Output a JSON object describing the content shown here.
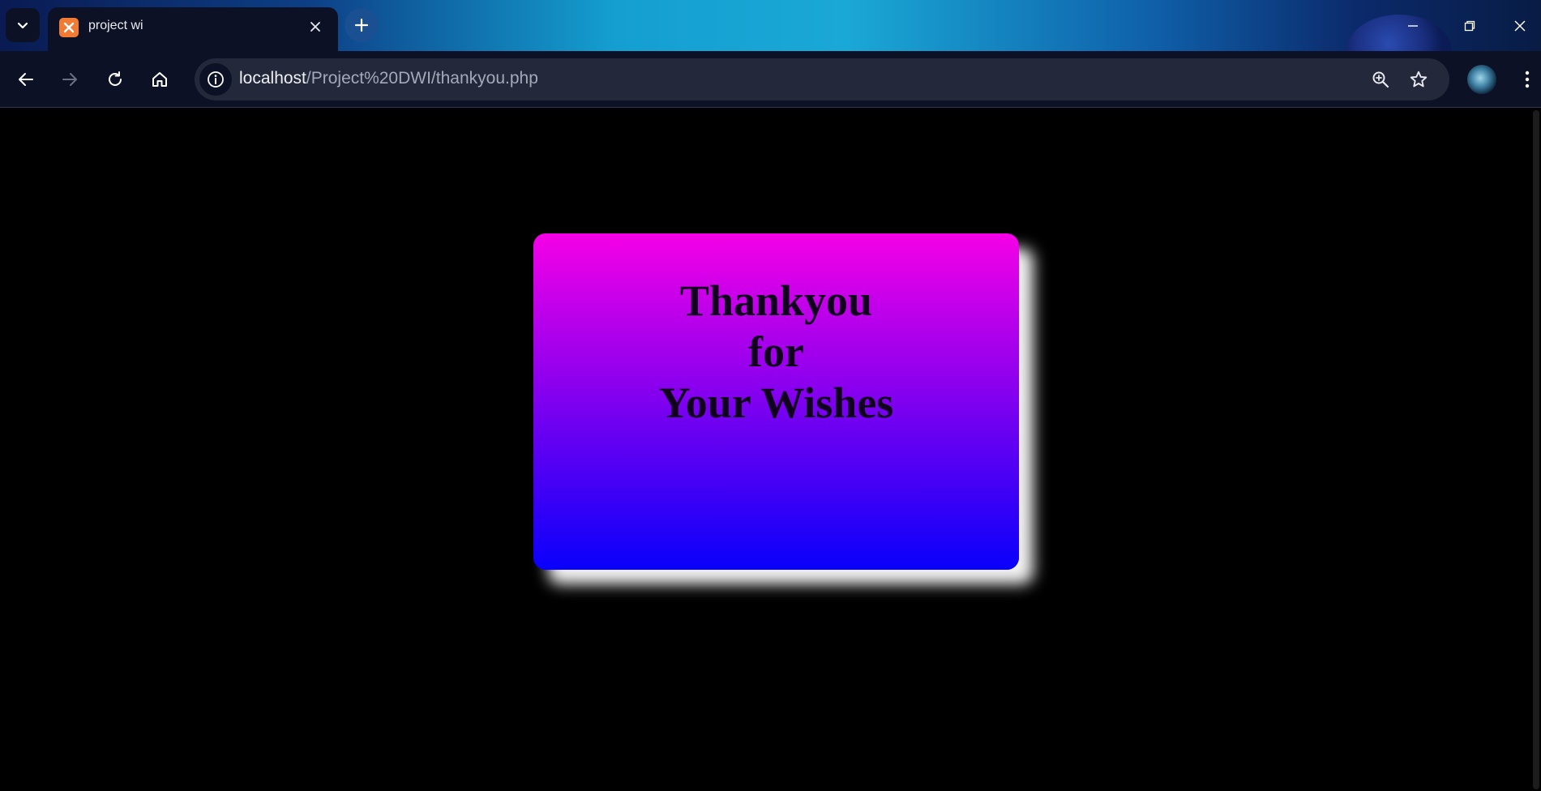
{
  "browser": {
    "tab": {
      "title": "project wi",
      "favicon": "xampp-icon"
    },
    "address": {
      "host": "localhost",
      "path": "/Project%20DWI/thankyou.php"
    },
    "icons": {
      "tab_search": "chevron-down-icon",
      "tab_close": "close-icon",
      "new_tab": "plus-icon",
      "back": "arrow-left-icon",
      "forward": "arrow-right-icon",
      "reload": "reload-icon",
      "home": "home-icon",
      "site_info": "info-icon",
      "zoom": "zoom-in-icon",
      "bookmark": "star-icon",
      "menu": "kebab-menu-icon",
      "minimize": "minimize-icon",
      "restore": "restore-icon",
      "close_window": "close-icon"
    }
  },
  "card": {
    "line1": "Thankyou",
    "line2": "for",
    "line3": "Your Wishes"
  },
  "colors": {
    "card_gradient_top": "#f500e6",
    "card_gradient_mid": "#8b00ee",
    "card_gradient_bottom": "#0800fb",
    "page_background": "#000000",
    "card_shadow": "#ffffff"
  }
}
